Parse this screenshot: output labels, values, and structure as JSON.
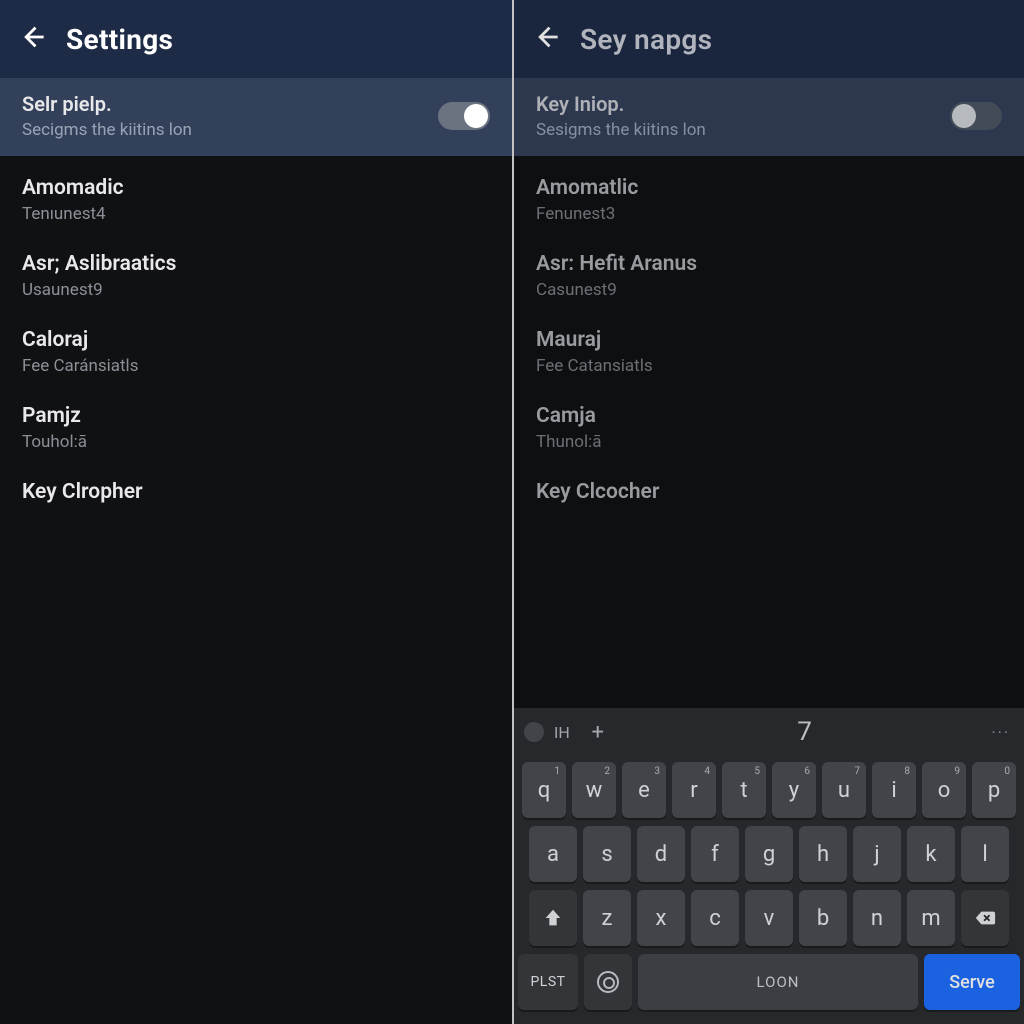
{
  "left": {
    "title": "Settings",
    "toggle": {
      "title": "Selr pielp.",
      "subtitle": "Secigms the kiitins lon",
      "on": true
    },
    "items": [
      {
        "title": "Amomadic",
        "subtitle": "Tenıunest4"
      },
      {
        "title": "Asr; Aslibraatics",
        "subtitle": "Usaunest9"
      },
      {
        "title": "Caloraj",
        "subtitle": "Fee Caránsiatls"
      },
      {
        "title": "Pamjz",
        "subtitle": "Touhol:ā"
      },
      {
        "title": "Key Clropher",
        "subtitle": ""
      }
    ]
  },
  "right": {
    "title": "Sey napgs",
    "toggle": {
      "title": "Key Iniop.",
      "subtitle": "Sesigms the kiitins lon",
      "on": false
    },
    "items": [
      {
        "title": "Amomatlic",
        "subtitle": "Fenunest3"
      },
      {
        "title": "Asr: Hefit Aranus",
        "subtitle": "Casunest9"
      },
      {
        "title": "Mauraj",
        "subtitle": "Fee Catansiatls"
      },
      {
        "title": "Camja",
        "subtitle": "Thunol:ā"
      },
      {
        "title": "Key Clcocher",
        "subtitle": ""
      }
    ]
  },
  "keyboard": {
    "suggestion_left": "IH",
    "suggestion_plus": "+",
    "suggestion_mid": "7",
    "suggestion_dots": "···",
    "rows": {
      "r1": [
        "q",
        "w",
        "e",
        "r",
        "t",
        "y",
        "u",
        "i",
        "o",
        "p"
      ],
      "r1_sup": [
        "1",
        "2",
        "3",
        "4",
        "5",
        "6",
        "7",
        "8",
        "9",
        "0"
      ],
      "r2": [
        "a",
        "s",
        "d",
        "f",
        "g",
        "h",
        "j",
        "k",
        "l"
      ],
      "r3": [
        "z",
        "x",
        "c",
        "v",
        "b",
        "n",
        "m"
      ]
    },
    "plst": "PLST",
    "space": "LOON",
    "action": "Serve"
  }
}
